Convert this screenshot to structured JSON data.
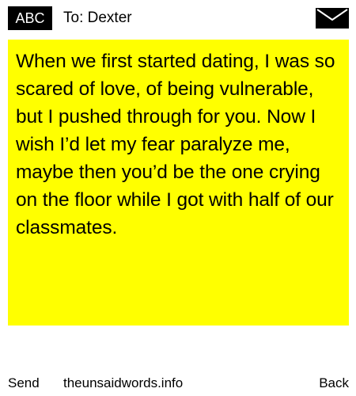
{
  "header": {
    "input_mode": "ABC",
    "recipient": "To: Dexter",
    "icon": "envelope-icon"
  },
  "message": {
    "text": "When we first started dating, I was so scared of love, of being vulnerable, but I pushed through for you. Now I wish I’d let my fear paralyze me, maybe then you’d be the one crying on the floor while I got with half of our classmates.",
    "background_color": "#ffff00"
  },
  "footer": {
    "left_soft_key": "Send",
    "site": "theunsaidwords.info",
    "right_soft_key": "Back"
  }
}
